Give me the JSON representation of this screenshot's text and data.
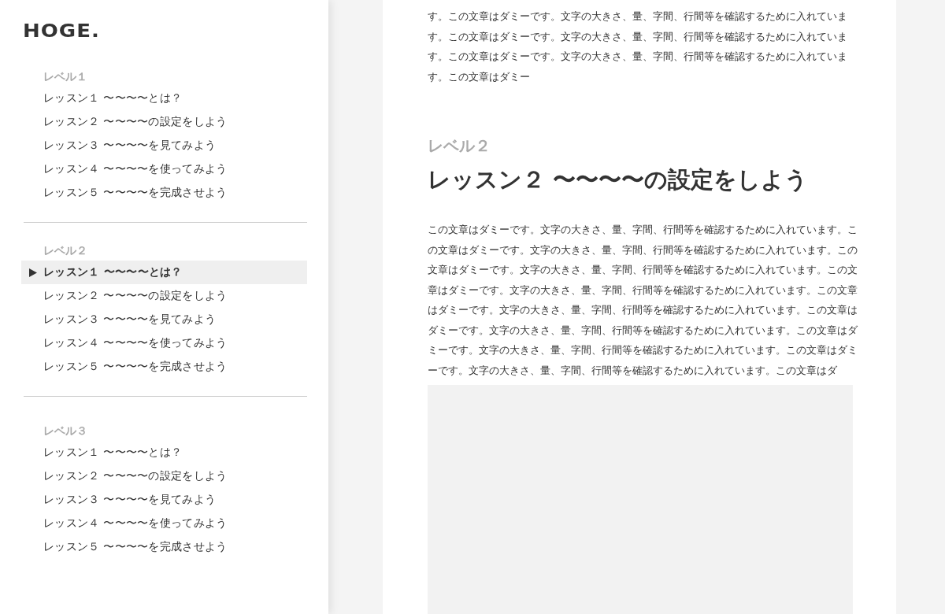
{
  "logo": "HOGE.",
  "sidebar": {
    "sections": [
      {
        "heading": "レベル１",
        "items": [
          {
            "label": "レッスン１ 〜〜〜〜とは？",
            "selected": false
          },
          {
            "label": "レッスン２ 〜〜〜〜の設定をしよう",
            "selected": false
          },
          {
            "label": "レッスン３ 〜〜〜〜を見てみよう",
            "selected": false
          },
          {
            "label": "レッスン４ 〜〜〜〜を使ってみよう",
            "selected": false
          },
          {
            "label": "レッスン５ 〜〜〜〜を完成させよう",
            "selected": false
          }
        ]
      },
      {
        "heading": "レベル２",
        "items": [
          {
            "label": "レッスン１ 〜〜〜〜とは？",
            "selected": true
          },
          {
            "label": "レッスン２ 〜〜〜〜の設定をしよう",
            "selected": false
          },
          {
            "label": "レッスン３ 〜〜〜〜を見てみよう",
            "selected": false
          },
          {
            "label": "レッスン４ 〜〜〜〜を使ってみよう",
            "selected": false
          },
          {
            "label": "レッスン５ 〜〜〜〜を完成させよう",
            "selected": false
          }
        ]
      },
      {
        "heading": "レベル３",
        "items": [
          {
            "label": "レッスン１ 〜〜〜〜とは？",
            "selected": false
          },
          {
            "label": "レッスン２ 〜〜〜〜の設定をしよう",
            "selected": false
          },
          {
            "label": "レッスン３ 〜〜〜〜を見てみよう",
            "selected": false
          },
          {
            "label": "レッスン４ 〜〜〜〜を使ってみよう",
            "selected": false
          },
          {
            "label": "レッスン５ 〜〜〜〜を完成させよう",
            "selected": false
          }
        ]
      }
    ]
  },
  "article": {
    "intro_text": "す。この文章はダミーです。文字の大きさ、量、字間、行間等を確認するために入れています。この文章はダミーです。文字の大きさ、量、字間、行間等を確認するために入れています。この文章はダミーです。文字の大きさ、量、字間、行間等を確認するために入れています。この文章はダミー",
    "level_label": "レベル２",
    "title": "レッスン２ 〜〜〜〜の設定をしよう",
    "body_text": "この文章はダミーです。文字の大きさ、量、字間、行間等を確認するために入れています。この文章はダミーです。文字の大きさ、量、字間、行間等を確認するために入れています。この文章はダミーです。文字の大きさ、量、字間、行間等を確認するために入れています。この文章はダミーです。文字の大きさ、量、字間、行間等を確認するために入れています。この文章はダミーです。文字の大きさ、量、字間、行間等を確認するために入れています。この文章はダミーです。文字の大きさ、量、字間、行間等を確認するために入れています。この文章はダミーです。文字の大きさ、量、字間、行間等を確認するために入れています。この文章はダミーです。文字の大きさ、量、字間、行間等を確認するために入れています。この文章はダ"
  }
}
